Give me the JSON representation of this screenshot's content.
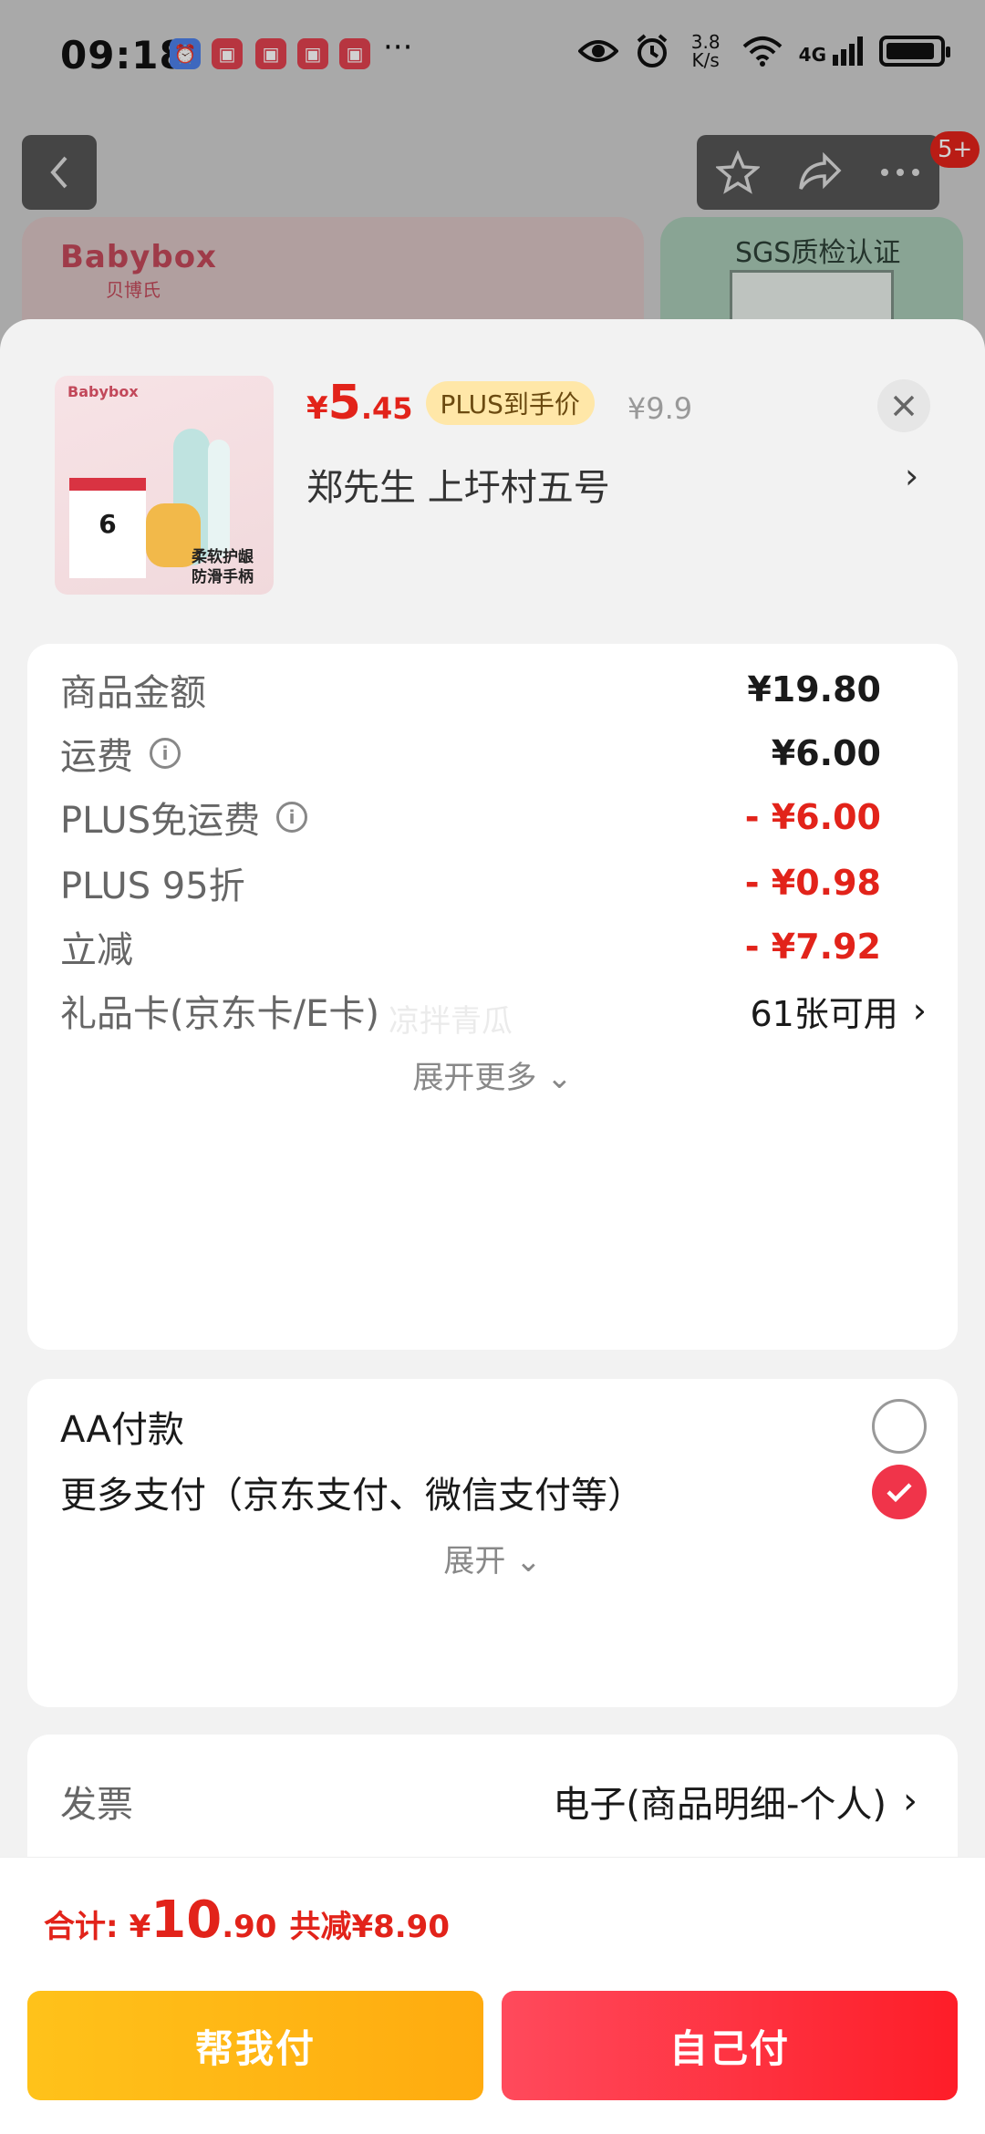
{
  "status_bar": {
    "time": "09:18",
    "more": "···",
    "net_speed_top": "3.8",
    "net_speed_bottom": "K/s",
    "network": "4G"
  },
  "background_page": {
    "brand": "Babybox",
    "brand_sub": "贝博氏",
    "right_card_title": "SGS质检认证",
    "badge": "5+"
  },
  "product": {
    "image_brand": "Babybox",
    "image_card_number": "6",
    "image_tag_line1": "柔软护龈",
    "image_tag_line2": "防滑手柄",
    "price_symbol": "¥",
    "price_int": "5",
    "price_dec": ".45",
    "plus_tag": "PLUS到手价",
    "original_price": "¥9.9",
    "address": "郑先生  上圩村五号",
    "address_chevron": "›"
  },
  "fees": {
    "rows": [
      {
        "label": "商品金额",
        "value": "¥19.80"
      },
      {
        "label": "运费",
        "value": "¥6.00"
      },
      {
        "label": "PLUS免运费",
        "value": "- ¥6.00"
      },
      {
        "label": "PLUS 95折",
        "value": "- ¥0.98"
      },
      {
        "label": "立减",
        "value": "- ¥7.92"
      }
    ],
    "gift_card_label": "礼品卡(京东卡/E卡)",
    "gift_card_value": "61张可用",
    "expand_more": "展开更多",
    "info_glyph": "i"
  },
  "payment": {
    "aa_label": "AA付款",
    "more_label": "更多支付（京东支付、微信支付等）",
    "expand": "展开"
  },
  "invoice": {
    "label": "发票",
    "value": "电子(商品明细-个人)"
  },
  "watermark": "凉拌青瓜",
  "footer": {
    "total_label": "合计:",
    "total_symbol": "¥",
    "total_int": "10",
    "total_dec": ".90",
    "total_saved": "共减¥8.90",
    "help_pay": "帮我付",
    "self_pay": "自己付"
  },
  "colors": {
    "accent_red": "#e2231a",
    "plus_tag_bg": "#ffe7a8",
    "help_button": "#ffc21a",
    "self_button": "#fe1d28"
  }
}
